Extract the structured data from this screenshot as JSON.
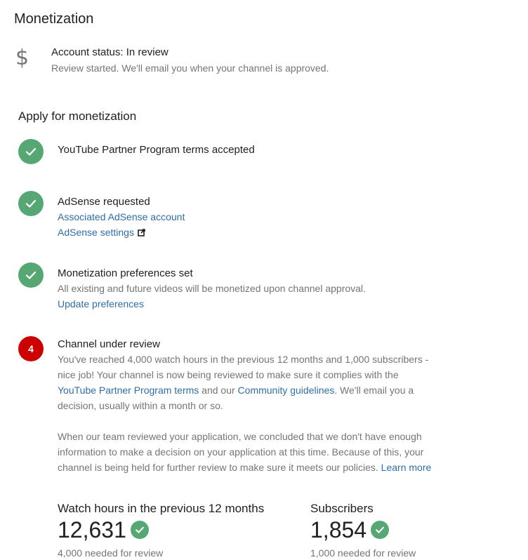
{
  "page": {
    "title": "Monetization"
  },
  "account_status": {
    "icon": "dollar-icon",
    "title": "Account status: In review",
    "description": "Review started. We'll email you when your channel is approved."
  },
  "apply": {
    "title": "Apply for monetization",
    "steps": [
      {
        "state": "done",
        "icon": "check-icon",
        "title": "YouTube Partner Program terms accepted"
      },
      {
        "state": "done",
        "icon": "check-icon",
        "title": "AdSense requested",
        "link1": "Associated AdSense account",
        "link2": "AdSense settings",
        "link2_icon": "external-link-icon"
      },
      {
        "state": "done",
        "icon": "check-icon",
        "title": "Monetization preferences set",
        "text": "All existing and future videos will be monetized upon channel approval.",
        "link1": "Update preferences"
      },
      {
        "state": "pending",
        "number": "4",
        "title": "Channel under review",
        "text_a": "You've reached 4,000 watch hours in the previous 12 months and 1,000 subscribers - nice job! Your channel is now being reviewed to make sure it complies with the ",
        "link_terms": "YouTube Partner Program terms",
        "text_b": " and our ",
        "link_guidelines": "Community guidelines",
        "text_c": ". We'll email you a decision, usually within a month or so.",
        "para2_text": "When our team reviewed your application, we concluded that we don't have enough information to make a decision on your application at this time. Because of this, your channel is being held for further review to make sure it meets our policies. ",
        "link_learn": "Learn more"
      }
    ]
  },
  "stats": {
    "watch_hours": {
      "label": "Watch hours in the previous 12 months",
      "value": "12,631",
      "needed": "4,000 needed for review",
      "icon": "check-icon"
    },
    "subscribers": {
      "label": "Subscribers",
      "value": "1,854",
      "needed": "1,000 needed for review",
      "icon": "check-icon"
    }
  },
  "colors": {
    "success": "#57a774",
    "pending": "#cc0000",
    "link": "#2f6ea8",
    "secondary_text": "#757575"
  }
}
